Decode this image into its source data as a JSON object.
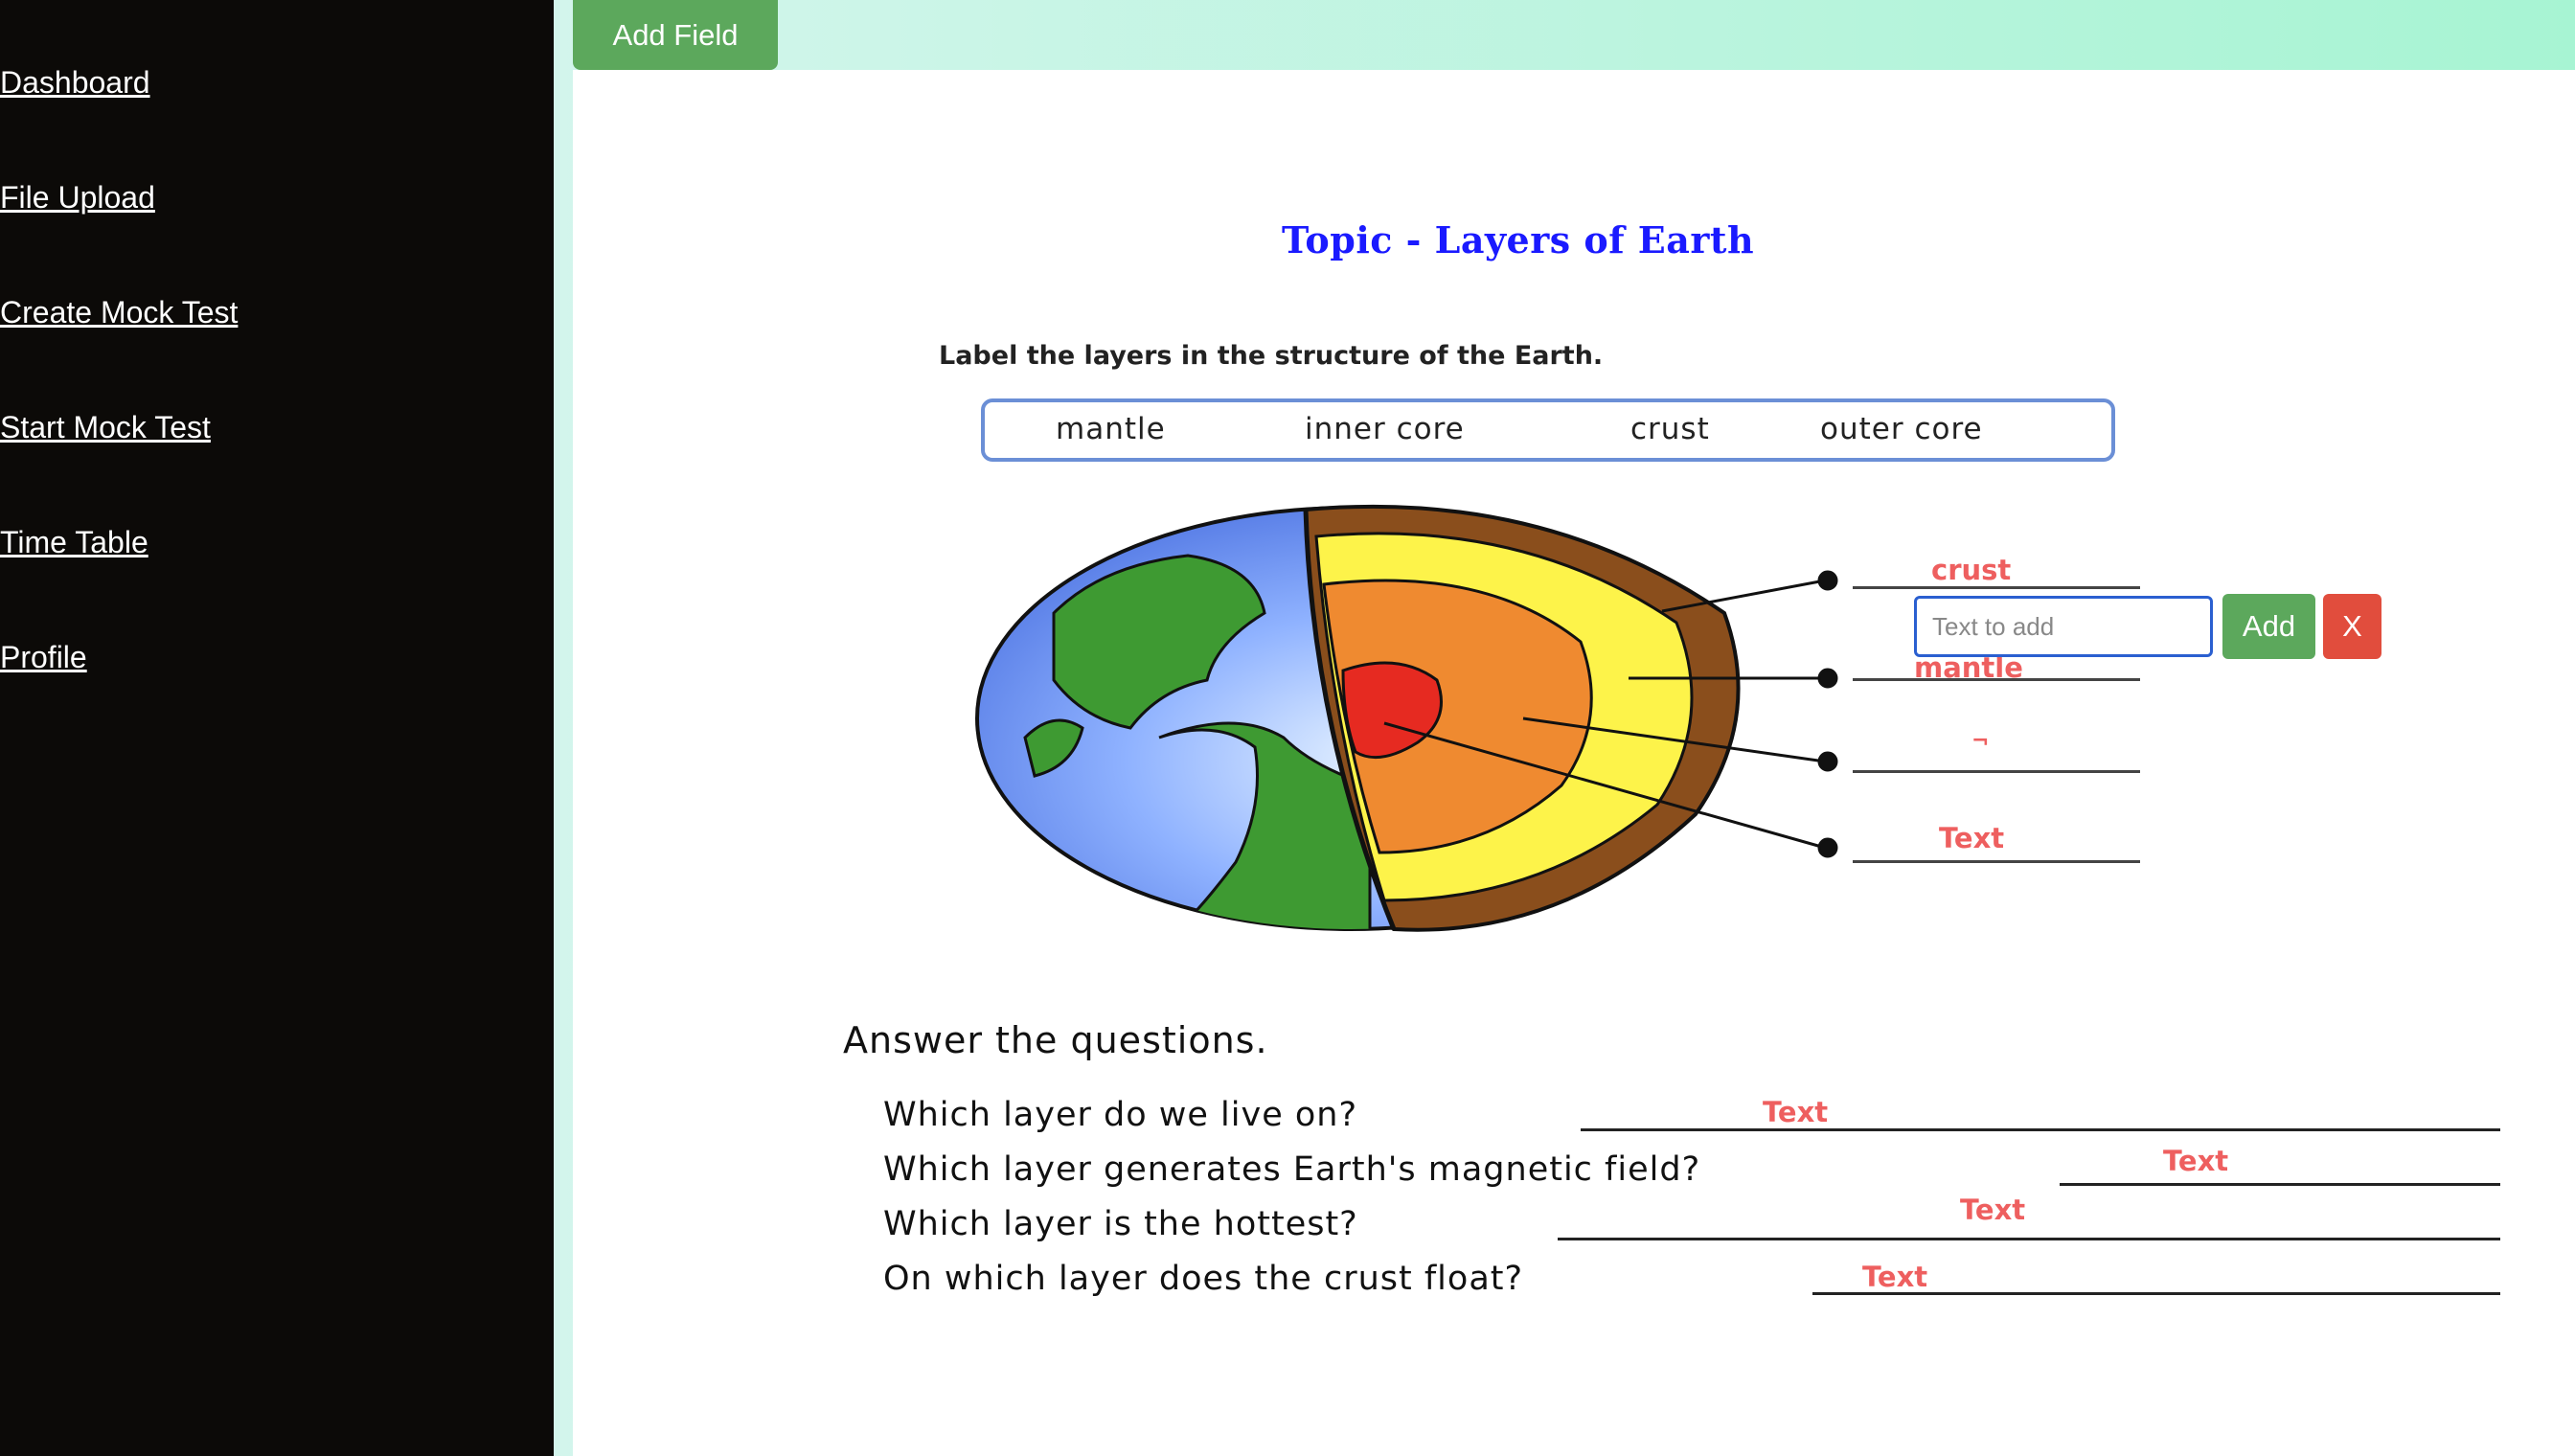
{
  "sidebar": {
    "links": [
      "Dashboard",
      "File Upload",
      "Create Mock Test",
      "Start Mock Test",
      "Time Table",
      "Profile"
    ]
  },
  "toolbar": {
    "add_field_label": "Add Field"
  },
  "worksheet": {
    "title": "Topic - Layers of Earth",
    "instruction": "Label the layers in the structure of the Earth.",
    "word_bank": [
      "mantle",
      "inner core",
      "crust",
      "outer core"
    ],
    "diagram_labels": [
      "crust",
      "mantle",
      "¬",
      "Text"
    ],
    "answer_heading": "Answer the questions.",
    "questions": [
      {
        "text": "Which layer do we live on?",
        "answer": "Text"
      },
      {
        "text": "Which layer generates Earth's magnetic field?",
        "answer": "Text"
      },
      {
        "text": "Which layer is the hottest?",
        "answer": "Text"
      },
      {
        "text": "On which layer does the crust float?",
        "answer": "Text"
      }
    ]
  },
  "editor": {
    "input_placeholder": "Text to add",
    "add_label": "Add",
    "close_label": "X"
  },
  "colors": {
    "sidebar_bg": "#0c0a08",
    "accent_green": "#5ca85c",
    "danger_red": "#e14d3d",
    "label_red": "#ee5f5f",
    "title_blue": "#1a1aff"
  }
}
